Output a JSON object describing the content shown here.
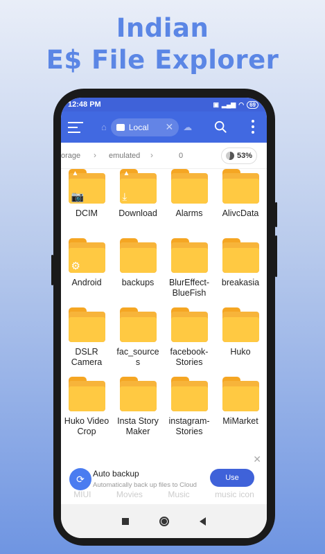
{
  "promo": {
    "line1": "Indian",
    "line2": "E$ File Explorer"
  },
  "status": {
    "time": "12:48 PM",
    "battery": "69"
  },
  "toolbar": {
    "tab_label": "Local"
  },
  "path": {
    "crumbs": [
      "orage",
      "emulated",
      "0"
    ],
    "storage_percent": "53%"
  },
  "folders": [
    {
      "label": "DCIM",
      "badge": "camera"
    },
    {
      "label": "Download",
      "badge": "download"
    },
    {
      "label": "Alarms",
      "badge": ""
    },
    {
      "label": "AlivcData",
      "badge": ""
    },
    {
      "label": "Android",
      "badge": "gear"
    },
    {
      "label": "backups",
      "badge": ""
    },
    {
      "label": "BlurEffect-\nBlueFish",
      "badge": ""
    },
    {
      "label": "breakasia",
      "badge": ""
    },
    {
      "label": "DSLR\nCamera",
      "badge": ""
    },
    {
      "label": "fac_source\ns",
      "badge": ""
    },
    {
      "label": "facebook-\nStories",
      "badge": ""
    },
    {
      "label": "Huko",
      "badge": ""
    },
    {
      "label": "Huko Video\nCrop",
      "badge": ""
    },
    {
      "label": "Insta Story\nMaker",
      "badge": ""
    },
    {
      "label": "instagram-\nStories",
      "badge": ""
    },
    {
      "label": "MiMarket",
      "badge": ""
    }
  ],
  "ghost_labels": [
    "MIUI",
    "Movies",
    "Music",
    "music icon"
  ],
  "banner": {
    "title": "Auto backup",
    "subtitle": "Automatically back up files to Cloud",
    "button": "Use"
  },
  "colors": {
    "accent": "#4169e1",
    "folder": "#ffc942",
    "headline": "#5b86e5"
  }
}
